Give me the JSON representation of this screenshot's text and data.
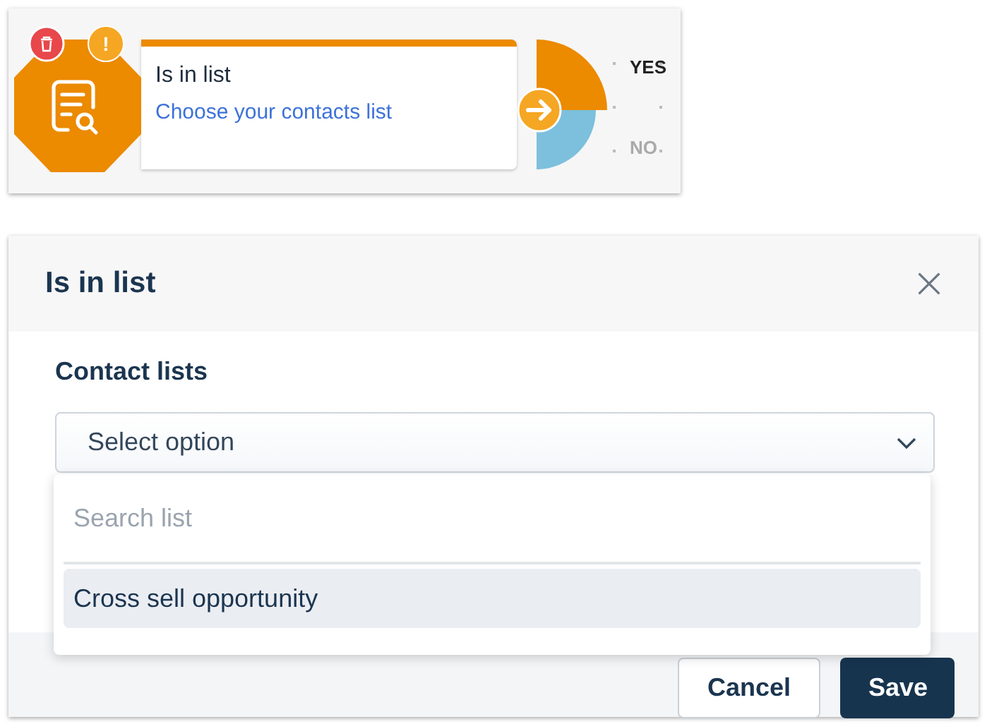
{
  "node": {
    "title": "Is in list",
    "subtitle": "Choose your contacts list",
    "warning": "!",
    "branches": [
      {
        "label": "YES",
        "highlighted": true
      },
      {
        "label": "NO",
        "highlighted": false
      }
    ]
  },
  "dialog": {
    "title": "Is in list",
    "field_label": "Contact lists",
    "select": {
      "placeholder": "Select option",
      "expanded": true
    },
    "dropdown": {
      "search_placeholder": "Search list",
      "options": [
        {
          "label": "Cross sell opportunity",
          "highlighted": true
        }
      ]
    },
    "buttons": [
      {
        "label": "Cancel",
        "kind": "secondary"
      },
      {
        "label": "Save",
        "kind": "primary"
      }
    ]
  }
}
